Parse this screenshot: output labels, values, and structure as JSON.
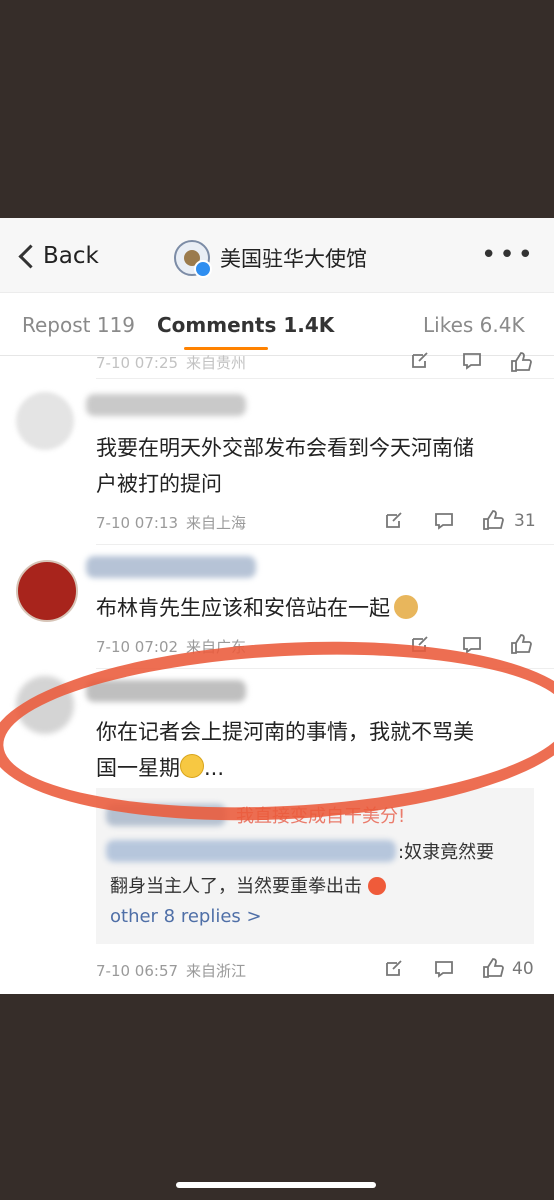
{
  "nav": {
    "back_label": "Back",
    "title": "美国驻华大使馆",
    "more": "•••"
  },
  "tabs": {
    "repost": "Repost 119",
    "comments": "Comments 1.4K",
    "likes": "Likes 6.4K"
  },
  "comments": [
    {
      "time": "7-10 07:25",
      "location": "来自贵州",
      "likes": ""
    },
    {
      "text_line1": "我要在明天外交部发布会看到今天河南储",
      "text_line2": "户被打的提问",
      "time": "7-10 07:13",
      "location": "来自上海",
      "likes": "31"
    },
    {
      "text": "布林肯先生应该和安倍站在一起",
      "time": "7-10 07:02",
      "location": "来自广东",
      "likes": ""
    },
    {
      "text_line1": "你在记者会上提河南的事情，我就不骂美",
      "text_line2": "国一星期",
      "text_suffix": "...",
      "time": "7-10 06:57",
      "location": "来自浙江",
      "likes": "40",
      "replies": {
        "reply1_text": "我直接变成自干美分!",
        "reply2_text": ":奴隶竟然要",
        "reply2_line2": "翻身当主人了，当然要重拳出击",
        "more_replies": "other 8 replies >"
      }
    }
  ],
  "colors": {
    "accent": "#ff8200",
    "link": "#4f6fa7",
    "marker": "#ea5a3a",
    "background": "#362d29"
  }
}
